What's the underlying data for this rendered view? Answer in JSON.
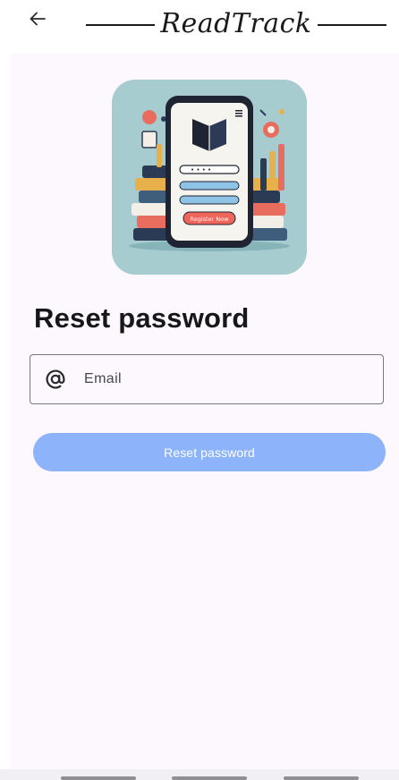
{
  "app": {
    "brand_title": "ReadTrack"
  },
  "hero": {
    "illustration_name": "book-app-register-illustration",
    "phone_button_label": "Register Now",
    "phone_field_text": "• • • •",
    "colors": {
      "background": "#a6ccd0",
      "phone_frame": "#1f2433",
      "accent": "#f0655a"
    }
  },
  "page": {
    "heading": "Reset password"
  },
  "form": {
    "email_placeholder": "Email",
    "email_value": "",
    "email_icon": "at-icon",
    "submit_label": "Reset password"
  },
  "colors": {
    "button": "#8db3fb",
    "surface": "#fcf8fd"
  },
  "system_nav": {
    "items": [
      "recent-apps",
      "home",
      "back"
    ]
  }
}
